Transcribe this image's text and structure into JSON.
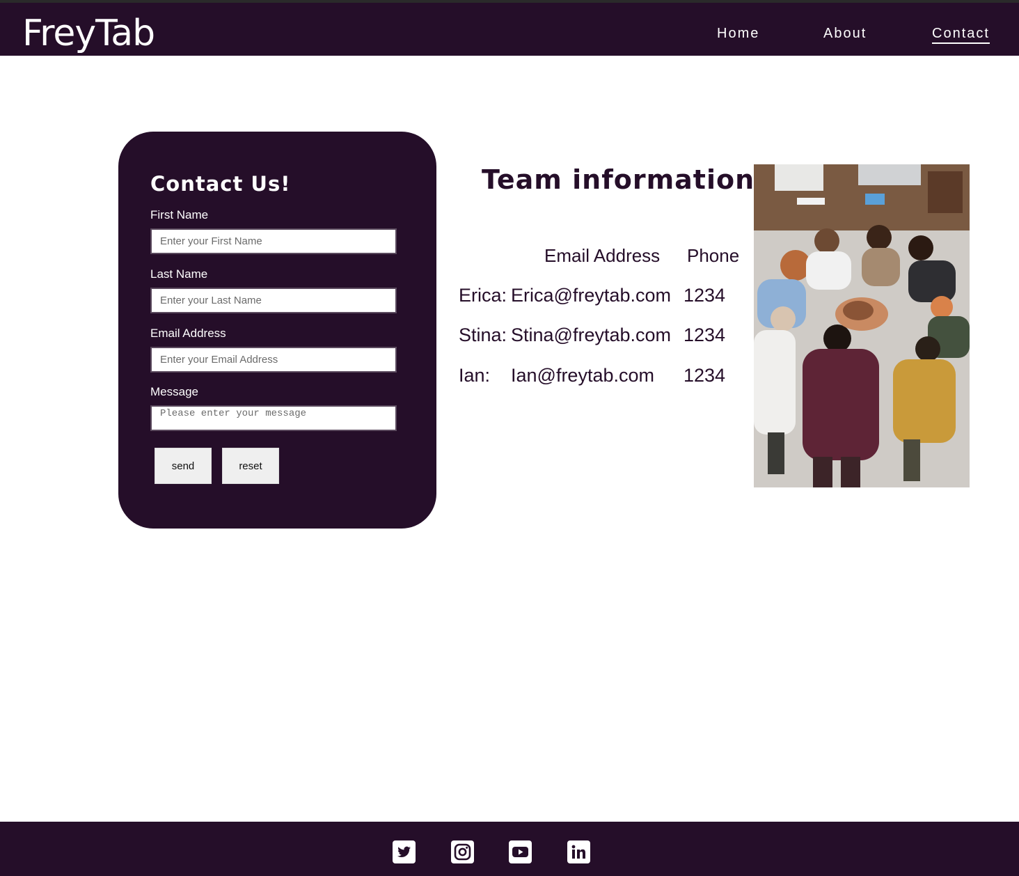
{
  "header": {
    "logo": "FreyTab",
    "nav": [
      {
        "label": "Home"
      },
      {
        "label": "About"
      },
      {
        "label": "Contact",
        "active": true
      }
    ]
  },
  "contact_form": {
    "title": "Contact Us!",
    "first_name": {
      "label": "First Name",
      "placeholder": "Enter your First Name"
    },
    "last_name": {
      "label": "Last Name",
      "placeholder": "Enter your Last Name"
    },
    "email": {
      "label": "Email Address",
      "placeholder": "Enter your Email Address"
    },
    "message": {
      "label": "Message",
      "placeholder": "Please enter your message"
    },
    "send_label": "send",
    "reset_label": "reset"
  },
  "team": {
    "title": "Team information",
    "headers": {
      "email": "Email Address",
      "phone": "Phone"
    },
    "rows": [
      {
        "name": "Erica:",
        "email": "Erica@freytab.com",
        "phone": "1234"
      },
      {
        "name": "Stina:",
        "email": "Stina@freytab.com",
        "phone": "1234"
      },
      {
        "name": "Ian:",
        "email": "Ian@freytab.com",
        "phone": "1234"
      }
    ]
  },
  "footer": {
    "social_icons": [
      "twitter-icon",
      "instagram-icon",
      "youtube-icon",
      "linkedin-icon"
    ]
  },
  "colors": {
    "brand": "#250e29",
    "button": "#efefef",
    "background": "#ffffff"
  }
}
